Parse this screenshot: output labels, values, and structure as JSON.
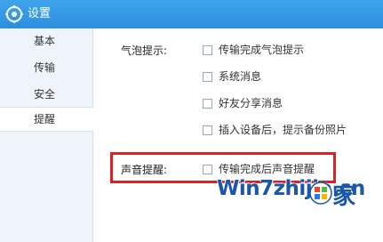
{
  "window": {
    "title": "设置"
  },
  "sidebar": {
    "items": [
      {
        "label": "基本"
      },
      {
        "label": "传输"
      },
      {
        "label": "安全"
      },
      {
        "label": "提醒"
      }
    ]
  },
  "bubble": {
    "label": "气泡提示:",
    "options": [
      {
        "label": "传输完成气泡提示",
        "checked": false
      },
      {
        "label": "系统消息",
        "checked": false
      },
      {
        "label": "好友分享消息",
        "checked": false
      },
      {
        "label": "插入设备后，提示备份照片",
        "checked": false
      }
    ]
  },
  "sound": {
    "label": "声音提醒:",
    "options": [
      {
        "label": "传输完成后声音提醒",
        "checked": false
      }
    ]
  },
  "watermark": {
    "text": "Win7zhijia.cn",
    "suffix": "家",
    "icon": "windows-logo",
    "color": "#1a57a8"
  },
  "colors": {
    "titlebar": "#2b8fde",
    "highlight": "#e02020"
  }
}
